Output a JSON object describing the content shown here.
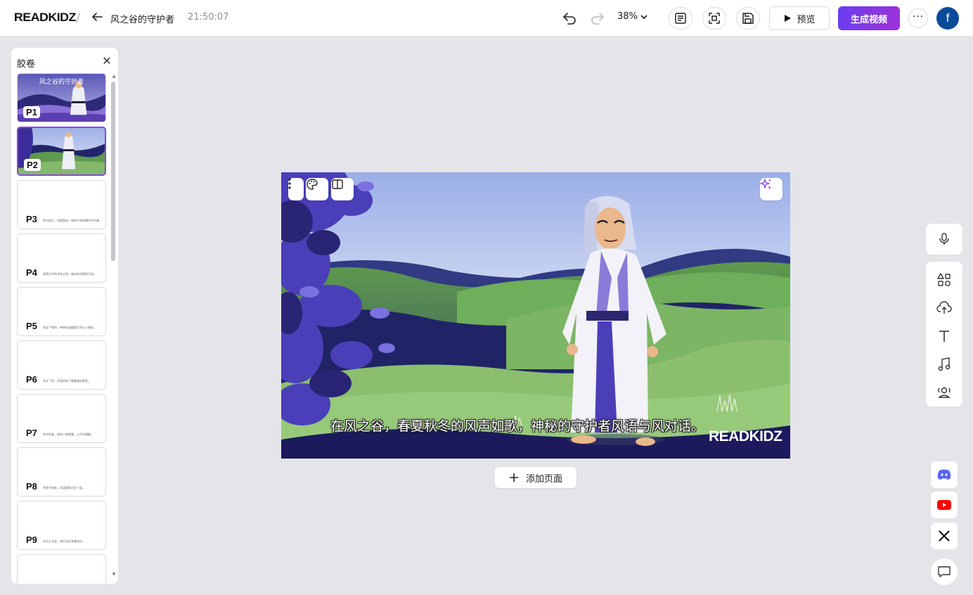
{
  "app": {
    "logo": "READKIDZ",
    "separator": "/"
  },
  "document": {
    "title": "风之谷的守护者",
    "time": "21:50:07"
  },
  "toolbar": {
    "zoom": "38%",
    "preview_label": "预览",
    "generate_label": "生成视频",
    "more_label": "···",
    "avatar_initial": "f"
  },
  "filmstrip": {
    "title": "胶卷",
    "close_label": "✕",
    "pages": [
      {
        "label": "P1",
        "title": "风之谷的守护者",
        "snippet": ""
      },
      {
        "label": "P2",
        "title": "",
        "snippet": ""
      },
      {
        "label": "P3",
        "title": "",
        "snippet": "的村民们，也就是这一带的平原和瀑布守护者。"
      },
      {
        "label": "P4",
        "title": "",
        "snippet": "缘是文中的寻找之地，城市的风景和河流。"
      },
      {
        "label": "P5",
        "title": "",
        "snippet": "的这个城市，带来的温暖和生命让人感叹。"
      },
      {
        "label": "P6",
        "title": "",
        "snippet": "花开了的，风语传说了最美丽的景色。"
      },
      {
        "label": "P7",
        "title": "",
        "snippet": "的守护者，他的人物故事，心中充满着。"
      },
      {
        "label": "P8",
        "title": "",
        "snippet": "的季节到来，风语者和大家一起。"
      },
      {
        "label": "P9",
        "title": "",
        "snippet": "在风之谷里，他们永远幸福快乐。"
      },
      {
        "label": "",
        "title": "",
        "snippet": ""
      }
    ]
  },
  "canvas": {
    "subtitle": "在风之谷，春夏秋冬的风声如歌，神秘的守护者风语与风对话。",
    "watermark": "READKIDZ"
  },
  "add_page_label": "添加页面",
  "colors": {
    "accent": "#8a44e8",
    "generate_gradient_start": "#6a3df0",
    "generate_gradient_end": "#9b33d9",
    "avatar_bg": "#0b4a99"
  },
  "icons": {
    "toolbar": [
      "back-arrow-icon",
      "undo-icon",
      "redo-icon",
      "chevron-down-icon",
      "script-icon",
      "fit-screen-icon",
      "save-icon",
      "play-icon"
    ],
    "canvas": [
      "vertical-dots-icon",
      "palette-icon",
      "split-layout-icon",
      "sparkle-icon"
    ],
    "rail": [
      "microphone-icon",
      "elements-icon",
      "upload-cloud-icon",
      "text-icon",
      "music-icon",
      "voice-character-icon"
    ],
    "social": [
      "discord-icon",
      "youtube-icon",
      "x-icon",
      "feedback-chat-icon"
    ]
  }
}
